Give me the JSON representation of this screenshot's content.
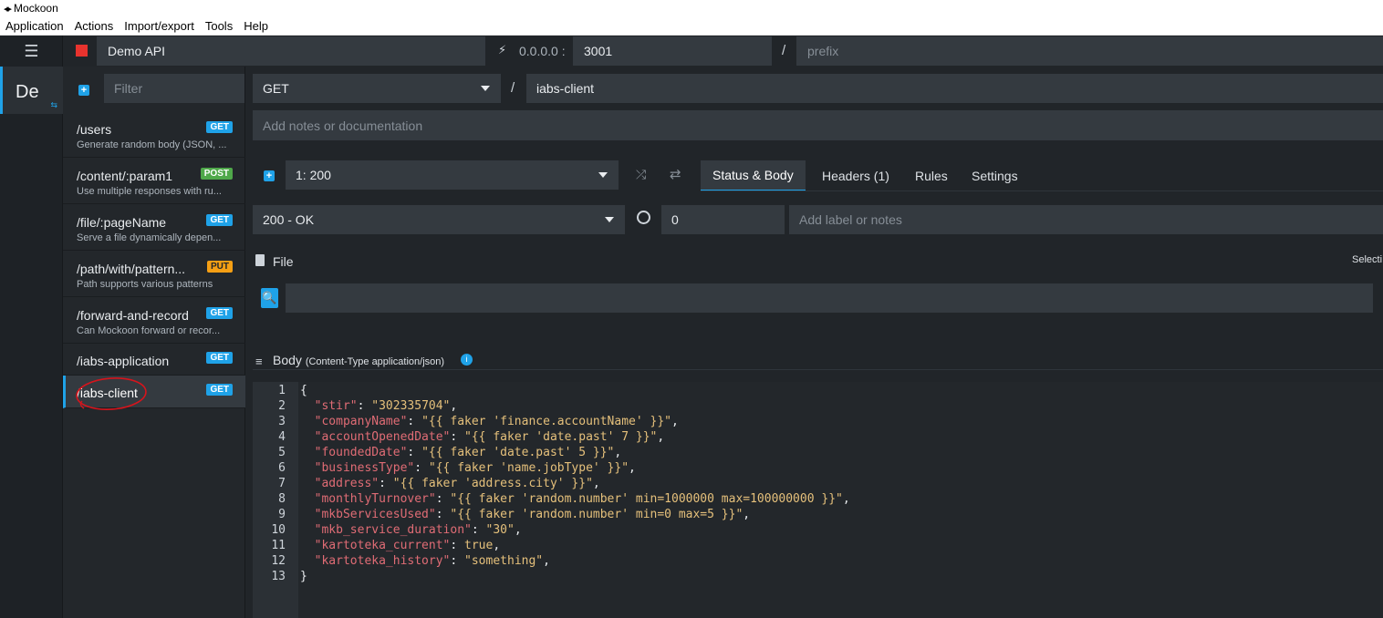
{
  "window": {
    "title": "Mockoon"
  },
  "menu": [
    "Application",
    "Actions",
    "Import/export",
    "Tools",
    "Help"
  ],
  "environment": {
    "short_name": "De",
    "name": "Demo API",
    "host": "0.0.0.0 :",
    "port": "3001",
    "prefix_placeholder": "prefix",
    "status_color": "#e8332e"
  },
  "routes_panel": {
    "filter_placeholder": "Filter",
    "routes": [
      {
        "path": "/users",
        "method": "GET",
        "description": "Generate random body (JSON, ..."
      },
      {
        "path": "/content/:param1",
        "method": "POST",
        "description": "Use multiple responses with ru..."
      },
      {
        "path": "/file/:pageName",
        "method": "GET",
        "description": "Serve a file dynamically depen..."
      },
      {
        "path": "/path/with/pattern...",
        "method": "PUT",
        "description": "Path supports various patterns"
      },
      {
        "path": "/forward-and-record",
        "method": "GET",
        "description": "Can Mockoon forward or recor..."
      },
      {
        "path": "/iabs-application",
        "method": "GET",
        "description": ""
      },
      {
        "path": "/iabs-client",
        "method": "GET",
        "description": ""
      }
    ],
    "active_index": 6
  },
  "route_editor": {
    "method": "GET",
    "slash": "/",
    "path": "iabs-client",
    "notes_placeholder": "Add notes or documentation",
    "response_select": "1: 200",
    "tabs": [
      "Status & Body",
      "Headers (1)",
      "Rules",
      "Settings"
    ],
    "active_tab": 0,
    "status_select": "200 - OK",
    "latency": "0",
    "label_placeholder": "Add label or notes",
    "file_label": "File",
    "file_right_label": "Selecti",
    "body_label": "Body",
    "body_content_type": "(Content-Type application/json)",
    "body_lines": [
      {
        "n": "1",
        "text": "{"
      },
      {
        "n": "2",
        "key": "\"stir\"",
        "value": "\"302335704\""
      },
      {
        "n": "3",
        "key": "\"companyName\"",
        "value": "\"{{ faker 'finance.accountName' }}\""
      },
      {
        "n": "4",
        "key": "\"accountOpenedDate\"",
        "value": "\"{{ faker 'date.past' 7 }}\""
      },
      {
        "n": "5",
        "key": "\"foundedDate\"",
        "value": "\"{{ faker 'date.past' 5 }}\""
      },
      {
        "n": "6",
        "key": "\"businessType\"",
        "value": "\"{{ faker 'name.jobType' }}\""
      },
      {
        "n": "7",
        "key": "\"address\"",
        "value": "\"{{ faker 'address.city' }}\""
      },
      {
        "n": "8",
        "key": "\"monthlyTurnover\"",
        "value": "\"{{ faker 'random.number' min=1000000 max=100000000 }}\""
      },
      {
        "n": "9",
        "key": "\"mkbServicesUsed\"",
        "value": "\"{{ faker 'random.number' min=0 max=5 }}\""
      },
      {
        "n": "10",
        "key": "\"mkb_service_duration\"",
        "value": "\"30\""
      },
      {
        "n": "11",
        "key": "\"kartoteka_current\"",
        "value": "true"
      },
      {
        "n": "12",
        "key": "\"kartoteka_history\"",
        "value": "\"something\""
      },
      {
        "n": "13",
        "text": "}"
      }
    ]
  },
  "colors": {
    "accent": "#1fa2e8",
    "get": "#1fa2e8",
    "post": "#4fa84a",
    "put": "#f59f14",
    "annotation": "#d6141c"
  }
}
